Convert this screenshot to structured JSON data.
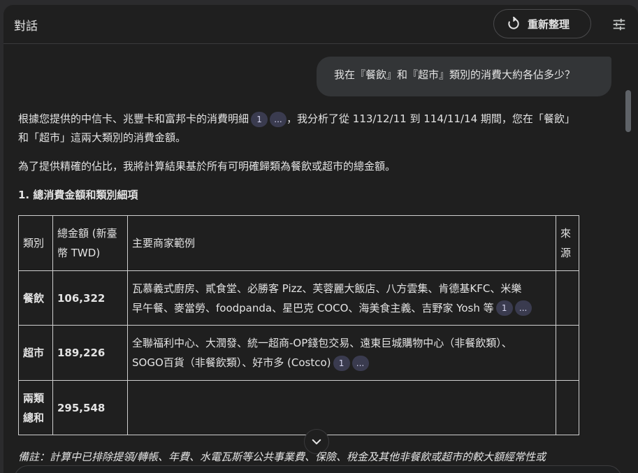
{
  "header": {
    "title": "對話",
    "refresh_label": "重新整理"
  },
  "user_message": "我在『餐飲』和『超市』類別的消費大約各佔多少？",
  "response": {
    "p1a": "根據您提供的中信卡、兆豐卡和富邦卡的消費明細",
    "p1b": "，我分析了從 113/12/11 到 114/11/14 期間，您在「餐飲」",
    "p1c": "和「超市」這兩大類別的消費金額。",
    "p2": "為了提供精確的佔比，我將計算結果基於所有可明確歸類為餐飲或超市的總金額。",
    "h1": "1. 總消費金額和類別細項",
    "cite_num": "1",
    "cite_more": "..."
  },
  "table": {
    "headers": {
      "category": "類別",
      "total_a": "總金額 (新臺",
      "total_b": "幣 TWD)",
      "merchants": "主要商家範例",
      "source_a": "來",
      "source_b": "源"
    },
    "rows": [
      {
        "category": "餐飲",
        "total": "106,322",
        "m1": "瓦慕義式廚房、貳食堂、必勝客 Pizz、芙蓉麗大飯店、八方雲集、肯德基KFC、米樂",
        "m2": "早午餐、麥當勞、foodpanda、星巴克 COCO、海美食主義、吉野家 Yosh 等"
      },
      {
        "category": "超市",
        "total": "189,226",
        "m1": "全聯福利中心、大潤發、統一超商-OP錢包交易、遠東巨城購物中心（非餐飲類）、",
        "m2": "SOGO百貨（非餐飲類）、好市多 (Costco)"
      },
      {
        "category_a": "兩類",
        "category_b": "總和",
        "total": "295,548"
      }
    ]
  },
  "note": "備註：計算中已排除提領/轉帳、年費、水電瓦斯等公共事業費、保險、稅金及其他非餐飲或超市的較大額經常性或"
}
